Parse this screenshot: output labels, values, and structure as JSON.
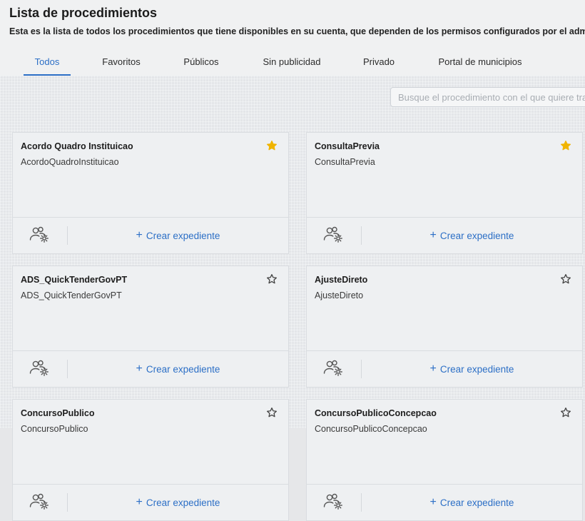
{
  "header": {
    "title": "Lista de procedimientos",
    "subtitle": "Esta es la lista de todos los procedimientos que tiene disponibles en su cuenta, que dependen de los permisos configurados por el admini"
  },
  "tabs": [
    {
      "label": "Todos",
      "active": true
    },
    {
      "label": "Favoritos",
      "active": false
    },
    {
      "label": "Públicos",
      "active": false
    },
    {
      "label": "Sin publicidad",
      "active": false
    },
    {
      "label": "Privado",
      "active": false
    },
    {
      "label": "Portal de municipios",
      "active": false
    }
  ],
  "search": {
    "placeholder": "Busque el procedimiento con el que quiere trabajar",
    "value": ""
  },
  "cards": [
    {
      "title": "Acordo Quadro Instituicao",
      "subtitle": "AcordoQuadroInstituicao",
      "favorite": true
    },
    {
      "title": "ConsultaPrevia",
      "subtitle": "ConsultaPrevia",
      "favorite": true
    },
    {
      "title": "ADS_QuickTenderGovPT",
      "subtitle": "ADS_QuickTenderGovPT",
      "favorite": false
    },
    {
      "title": "AjusteDireto",
      "subtitle": "AjusteDireto",
      "favorite": false
    },
    {
      "title": "ConcursoPublico",
      "subtitle": "ConcursoPublico",
      "favorite": false
    },
    {
      "title": "ConcursoPublicoConcepcao",
      "subtitle": "ConcursoPublicoConcepcao",
      "favorite": false
    }
  ],
  "card_actions": {
    "create_label": "Crear expediente",
    "config_icon": "users-gear-icon"
  },
  "colors": {
    "accent": "#2c6fc6",
    "star_filled": "#f0b400",
    "star_outline": "#444444"
  }
}
